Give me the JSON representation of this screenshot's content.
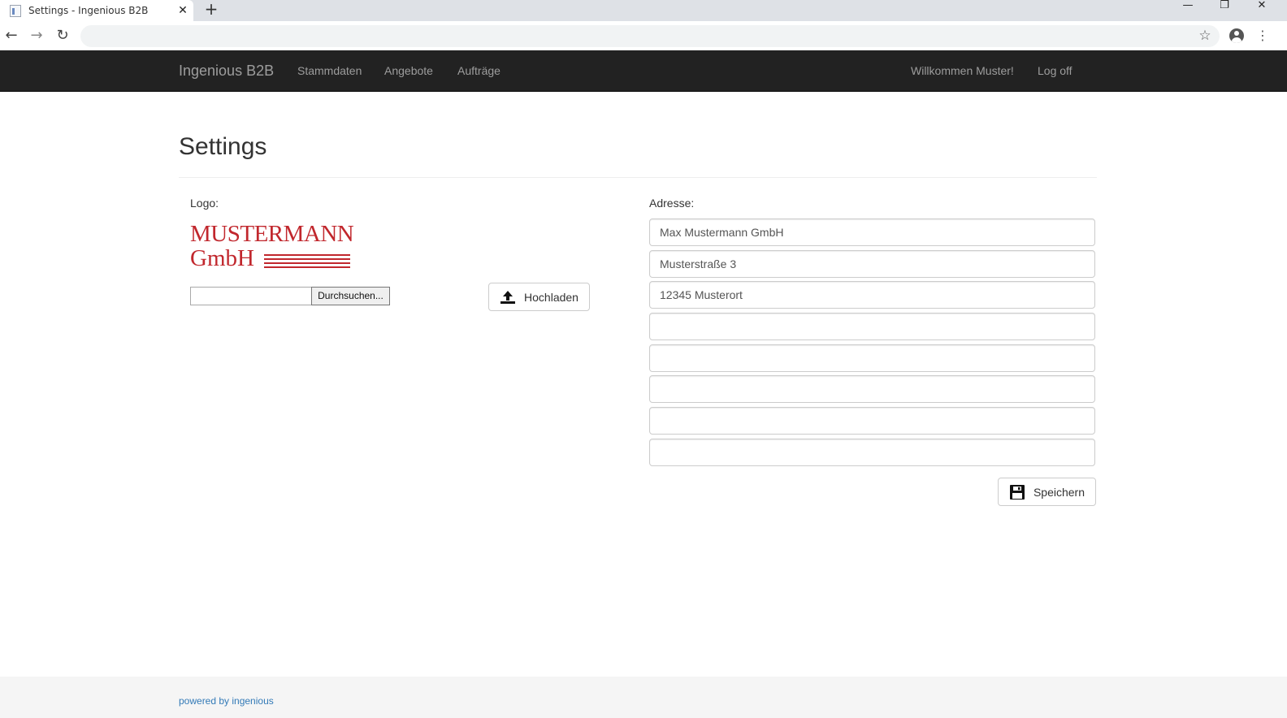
{
  "browser": {
    "tab_title": "Settings - Ingenious B2B",
    "tab_close": "✕",
    "new_tab": "+",
    "minimize": "—",
    "restore": "❐",
    "close": "✕",
    "back": "←",
    "forward": "→",
    "reload": "↻",
    "address_value": "",
    "bookmark": "☆",
    "menu": "⋮"
  },
  "navbar": {
    "brand": "Ingenious B2B",
    "links": [
      "Stammdaten",
      "Angebote",
      "Aufträge"
    ],
    "welcome": "Willkommen Muster!",
    "logoff": "Log off",
    "background": "#222222",
    "text_color": "#9d9d9d"
  },
  "page": {
    "title": "Settings"
  },
  "logo_section": {
    "label": "Logo:",
    "logo_line1": "MUSTERMANN",
    "logo_line2": "GmbH",
    "logo_color": "#c1272d",
    "browse_button": "Durchsuchen...",
    "upload_button": "Hochladen",
    "upload_icon": "upload-icon"
  },
  "address_section": {
    "label": "Adresse:",
    "fields": [
      "Max Mustermann GmbH",
      "Musterstraße 3",
      "12345 Musterort",
      "",
      "",
      "",
      "",
      ""
    ],
    "save_button": "Speichern",
    "save_icon": "floppy-disk-icon"
  },
  "footer": {
    "text": "powered by ingenious",
    "link_color": "#337ab7"
  }
}
